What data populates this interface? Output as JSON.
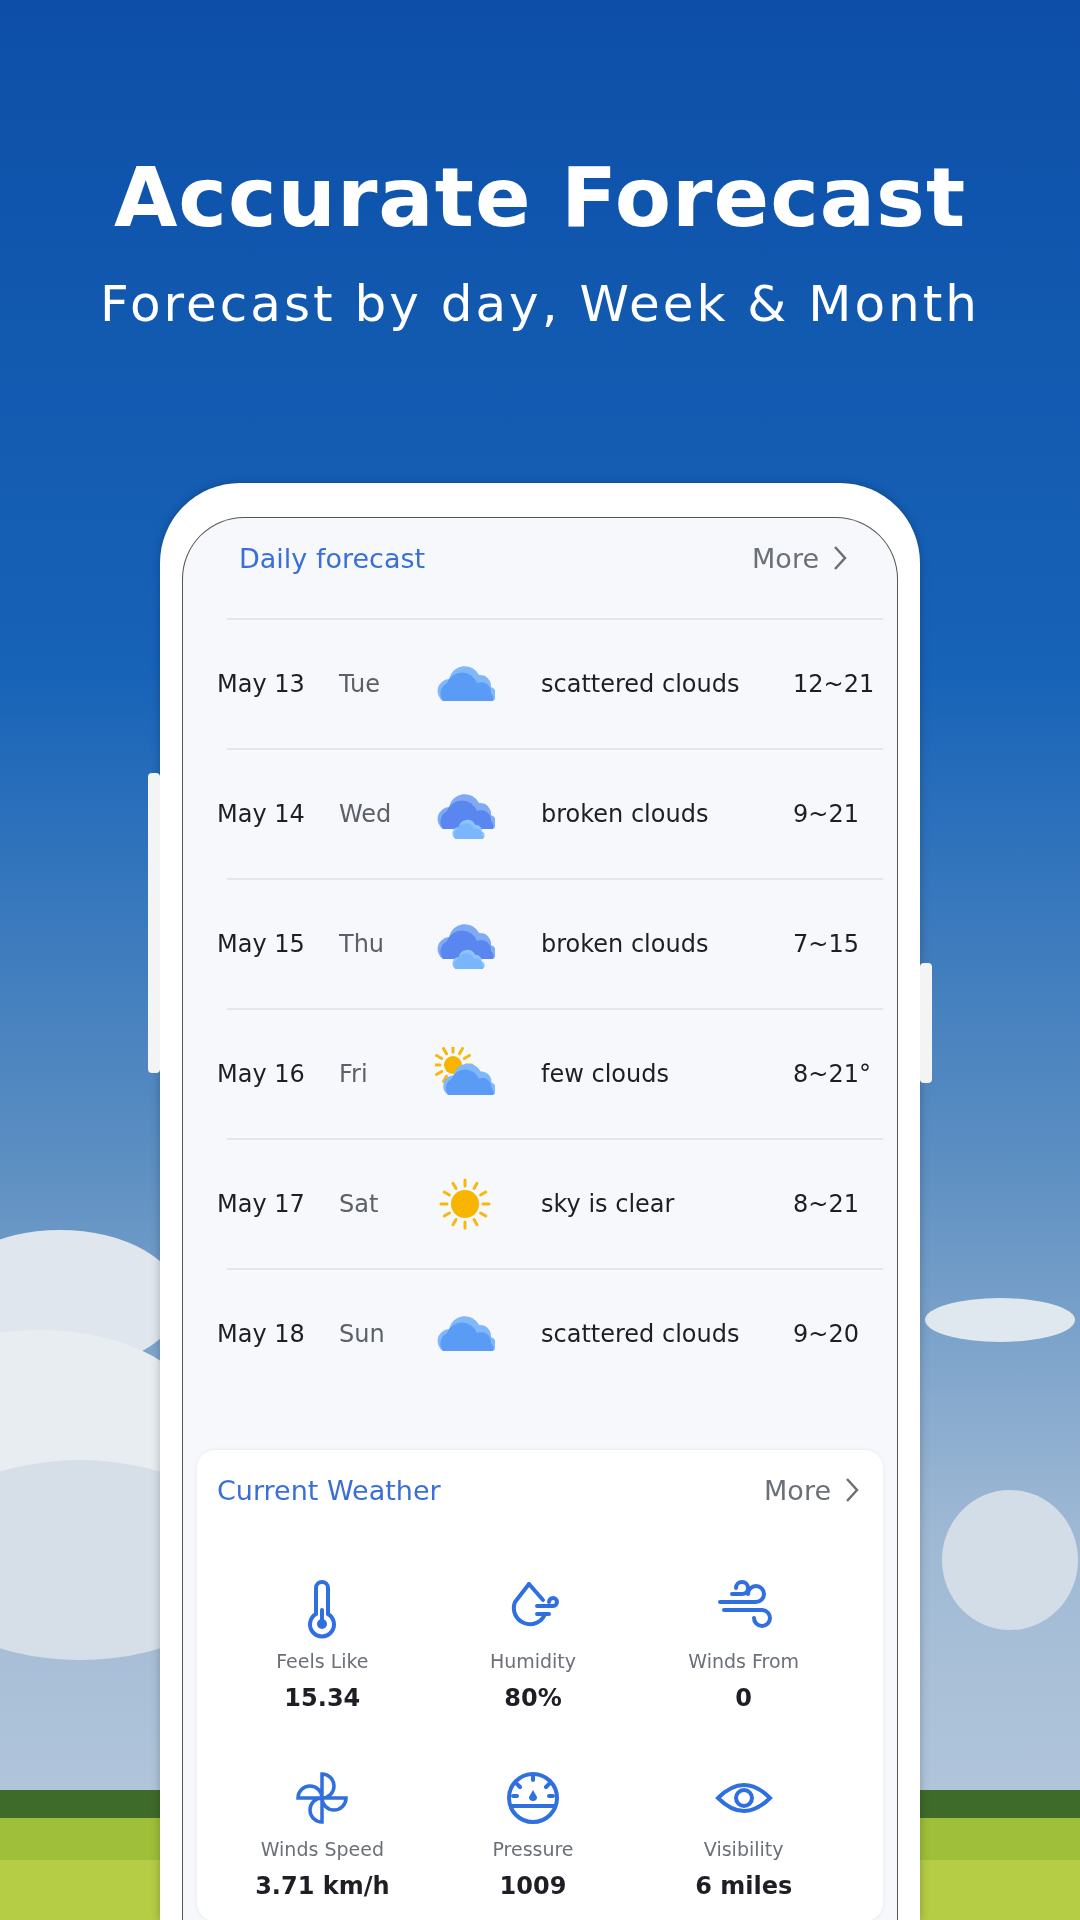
{
  "headline": {
    "title": "Accurate Forecast",
    "subtitle": "Forecast by day, Week & Month"
  },
  "daily_forecast": {
    "title": "Daily forecast",
    "more": "More",
    "rows": [
      {
        "date": "May 13",
        "day": "Tue",
        "kind": "cloud",
        "description": "scattered clouds",
        "temps": "12~21"
      },
      {
        "date": "May 14",
        "day": "Wed",
        "kind": "clouds",
        "description": "broken clouds",
        "temps": "9~21"
      },
      {
        "date": "May 15",
        "day": "Thu",
        "kind": "clouds",
        "description": "broken clouds",
        "temps": "7~15"
      },
      {
        "date": "May 16",
        "day": "Fri",
        "kind": "sun-cloud",
        "description": "few clouds",
        "temps": "8~21°"
      },
      {
        "date": "May 17",
        "day": "Sat",
        "kind": "sun",
        "description": "sky is clear",
        "temps": "8~21"
      },
      {
        "date": "May 18",
        "day": "Sun",
        "kind": "cloud",
        "description": "scattered clouds",
        "temps": "9~20"
      }
    ]
  },
  "current_weather": {
    "title": "Current Weather",
    "more": "More",
    "items": [
      {
        "kind": "thermometer",
        "label": "Feels Like",
        "value": "15.34"
      },
      {
        "kind": "humidity",
        "label": "Humidity",
        "value": "80%"
      },
      {
        "kind": "wind",
        "label": "Winds From",
        "value": "0"
      },
      {
        "kind": "pinwheel",
        "label": "Winds Speed",
        "value": "3.71 km/h"
      },
      {
        "kind": "gauge",
        "label": "Pressure",
        "value": "1009"
      },
      {
        "kind": "eye",
        "label": "Visibility",
        "value": "6 miles"
      }
    ]
  }
}
